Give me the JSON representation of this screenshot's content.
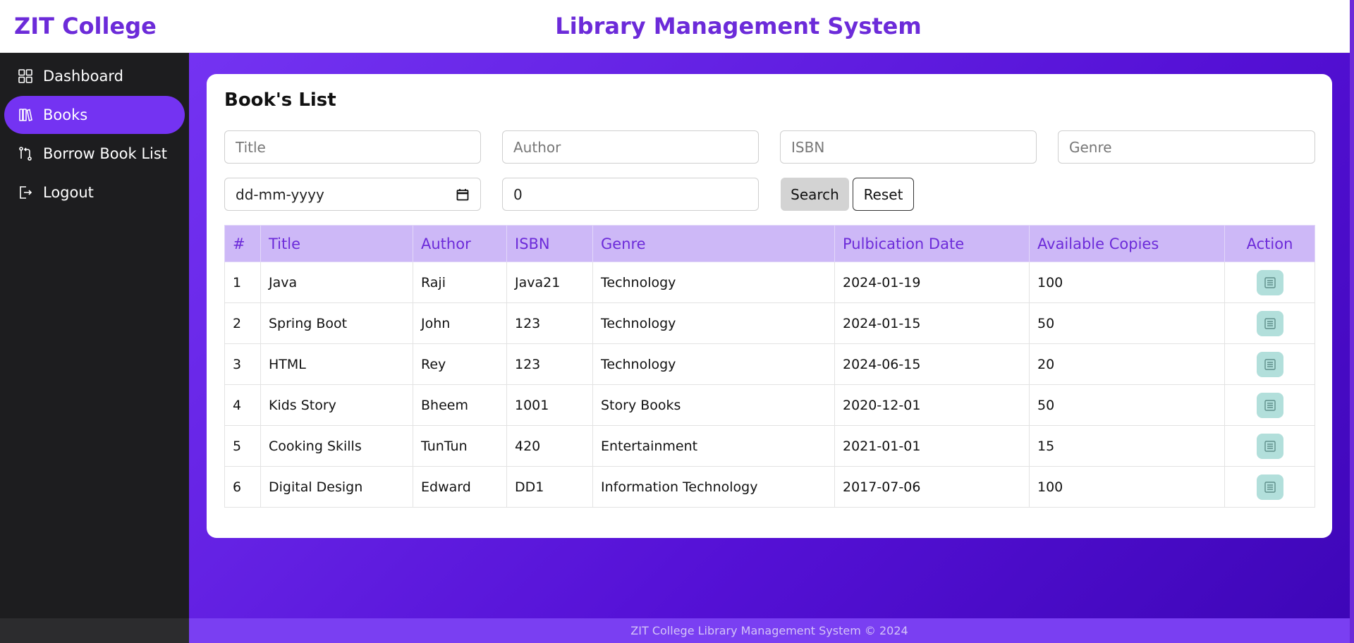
{
  "header": {
    "brand": "ZIT College",
    "title": "Library Management System"
  },
  "sidebar": {
    "items": [
      {
        "label": "Dashboard",
        "icon": "dashboard-grid-icon",
        "active": false
      },
      {
        "label": "Books",
        "icon": "books-icon",
        "active": true
      },
      {
        "label": "Borrow Book List",
        "icon": "borrow-icon",
        "active": false
      },
      {
        "label": "Logout",
        "icon": "logout-icon",
        "active": false
      }
    ]
  },
  "main": {
    "card_title": "Book's List",
    "filters": {
      "title_placeholder": "Title",
      "author_placeholder": "Author",
      "isbn_placeholder": "ISBN",
      "genre_placeholder": "Genre",
      "date_placeholder": "dd-mm-yyyy",
      "copies_value": "0"
    },
    "buttons": {
      "search": "Search",
      "reset": "Reset"
    },
    "table": {
      "headers": [
        "#",
        "Title",
        "Author",
        "ISBN",
        "Genre",
        "Pulbication Date",
        "Available Copies",
        "Action"
      ],
      "rows": [
        [
          "1",
          "Java",
          "Raji",
          "Java21",
          "Technology",
          "2024-01-19",
          "100"
        ],
        [
          "2",
          "Spring Boot",
          "John",
          "123",
          "Technology",
          "2024-01-15",
          "50"
        ],
        [
          "3",
          "HTML",
          "Rey",
          "123",
          "Technology",
          "2024-06-15",
          "20"
        ],
        [
          "4",
          "Kids Story",
          "Bheem",
          "1001",
          "Story Books",
          "2020-12-01",
          "50"
        ],
        [
          "5",
          "Cooking Skills",
          "TunTun",
          "420",
          "Entertainment",
          "2021-01-01",
          "15"
        ],
        [
          "6",
          "Digital Design",
          "Edward",
          "DD1",
          "Information Technology",
          "2017-07-06",
          "100"
        ]
      ]
    }
  },
  "footer": {
    "text": "ZIT College Library Management System © 2024"
  },
  "colors": {
    "accent": "#6c2bd9",
    "active_nav": "#7433f2",
    "table_header_bg": "#cdb8f7",
    "action_button_bg": "#b2dfdb"
  }
}
